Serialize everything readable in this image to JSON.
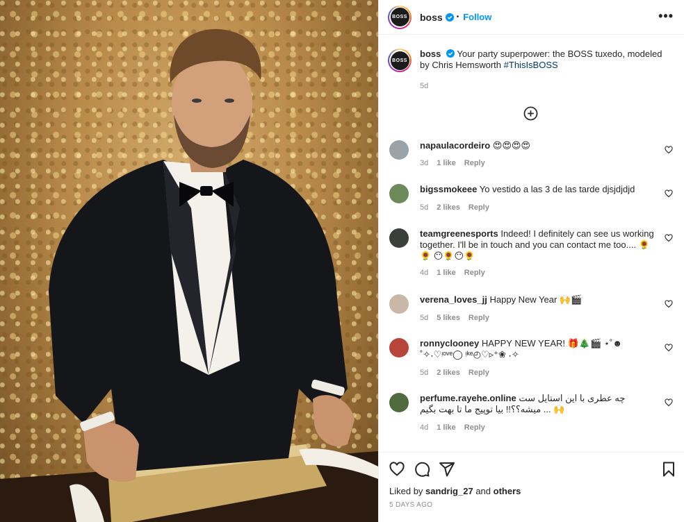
{
  "post": {
    "media_alt": "Man in black tuxedo wrapping gold gift box",
    "header": {
      "username": "boss",
      "avatar_text": "BOSS",
      "dot": "•",
      "follow_label": "Follow",
      "more_label": "•••"
    },
    "caption": {
      "username": "boss",
      "text": "Your party superpower: the BOSS tuxedo, modeled by Chris Hemsworth",
      "hashtag": "#ThisIsBOSS",
      "time": "5d"
    },
    "comments": [
      {
        "username": "napaulacordeiro",
        "text": "😍😍😍😍",
        "time": "3d",
        "likes": "1 like",
        "reply": "Reply",
        "avatar_color": "#9aa3a8"
      },
      {
        "username": "bigssmokeee",
        "text": "Yo vestido a las 3 de las tarde djsjdjdjd",
        "time": "5d",
        "likes": "2 likes",
        "reply": "Reply",
        "avatar_color": "#6d8a5a"
      },
      {
        "username": "teamgreenesports",
        "text": "Indeed! I definitely can see us working together. I'll be in touch and you can contact me too.... 🌻🌻 😶🌻😶🌻",
        "time": "4d",
        "likes": "1 like",
        "reply": "Reply",
        "avatar_color": "#3a3f3b"
      },
      {
        "username": "verena_loves_jj",
        "text": "Happy New Year 🙌🎬",
        "time": "5d",
        "likes": "5 likes",
        "reply": "Reply",
        "avatar_color": "#c9b8a8"
      },
      {
        "username": "ronnyclooney",
        "text": "HAPPY NEW YEAR! 🎁🎄🎬 ⋆˚☻˚✧˖♡ᵎᵒᵛᵉ◯ ᵎᵏᵉ◴♡▹⁺❀ ˖✧",
        "time": "5d",
        "likes": "2 likes",
        "reply": "Reply",
        "avatar_color": "#b8453a"
      },
      {
        "username": "perfume.rayehe.online",
        "text": "چه عطری با این استایل ست میشه؟؟!! بیا توپیج ما تا بهت بگیم ... 🙌",
        "time": "4d",
        "likes": "1 like",
        "reply": "Reply",
        "avatar_color": "#4f6b3d"
      }
    ],
    "liked_by_prefix": "Liked by",
    "liked_by_user": "sandrig_27",
    "liked_by_and": "and",
    "liked_by_others": "others",
    "posted_ago": "5 DAYS AGO"
  },
  "colors": {
    "accent": "#0095f6",
    "hashtag": "#00376b",
    "muted": "#8e8e8e",
    "border": "#efefef"
  }
}
